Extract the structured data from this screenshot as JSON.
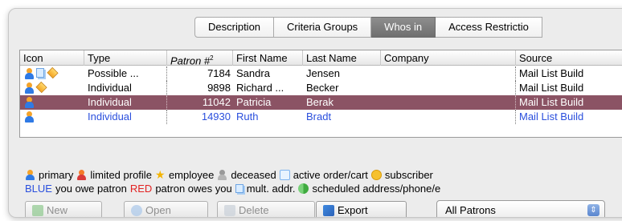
{
  "tabs": [
    {
      "label": "Description",
      "active": false
    },
    {
      "label": "Criteria Groups",
      "active": false
    },
    {
      "label": "Whos in",
      "active": true
    },
    {
      "label": "Access Restrictio",
      "active": false
    }
  ],
  "table": {
    "headers": [
      "Icon",
      "Type",
      "Patron #",
      "First Name",
      "Last Name",
      "Company",
      "Source"
    ],
    "patron_sort_marker": "2",
    "rows": [
      {
        "icons": [
          "person-icon",
          "multi-address-icon",
          "order-icon"
        ],
        "type": "Possible ...",
        "patron": "7184",
        "first": "Sandra",
        "last": "Jensen",
        "company": "",
        "source": "Mail List Build",
        "state": "normal"
      },
      {
        "icons": [
          "person-icon",
          "order-icon"
        ],
        "type": "Individual",
        "patron": "9898",
        "first": "Richard ...",
        "last": "Becker",
        "company": "",
        "source": "Mail List Build",
        "state": "normal"
      },
      {
        "icons": [
          "person-icon"
        ],
        "type": "Individual",
        "patron": "11042",
        "first": "Patricia",
        "last": "Berak",
        "company": "",
        "source": "Mail List Build",
        "state": "selected"
      },
      {
        "icons": [
          "person-icon"
        ],
        "type": "Individual",
        "patron": "14930",
        "first": "Ruth",
        "last": "Bradt",
        "company": "",
        "source": "Mail List Build",
        "state": "blue"
      }
    ]
  },
  "legend": {
    "line1": {
      "primary": "primary",
      "limited": "limited profile",
      "employee": "employee",
      "deceased": "deceased",
      "order": "active order/cart",
      "subscriber": "subscriber"
    },
    "line2": {
      "blue_word": "BLUE",
      "blue_text": "you owe patron",
      "red_word": "RED",
      "red_text": "patron owes you",
      "multi": "mult. addr.",
      "scheduled": "scheduled address/phone/e"
    }
  },
  "buttons": {
    "new": "New",
    "open": "Open",
    "delete": "Delete",
    "export": "Export"
  },
  "filter": {
    "selected": "All Patrons"
  },
  "colors": {
    "selected_row": "#8b5364",
    "owe_blue": "#2a4fdd",
    "owes_red": "#e22222",
    "active_tab": "#7a7a7a"
  }
}
